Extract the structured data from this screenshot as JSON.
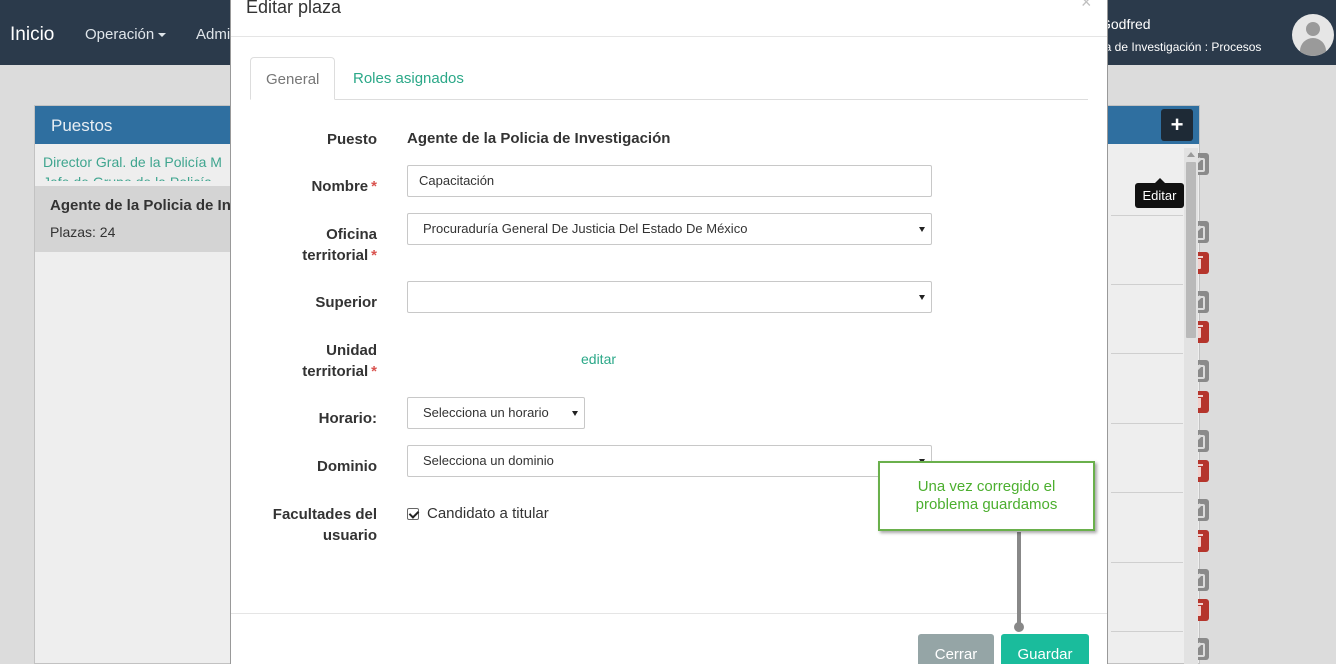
{
  "navbar": {
    "brand": "Inicio",
    "operacion": "Operación",
    "admin": "Admi",
    "user_name": "Godfred",
    "user_role": "cia de Investigación : Procesos"
  },
  "panel": {
    "title": "Puestos",
    "add_label": "+",
    "link1": "Director Gral. de la Policía M",
    "link2": "Jefe de Grupo de la Policía",
    "selected_title": "Agente de la Policia de Inve",
    "selected_plazas": "Plazas: 24",
    "tooltip": "Editar"
  },
  "modal": {
    "title": "Editar plaza",
    "close": "×",
    "tabs": [
      "General",
      "Roles asignados"
    ],
    "fields": {
      "puesto_label": "Puesto",
      "puesto_value": "Agente de la Policia de Investigación",
      "nombre_label": "Nombre",
      "nombre_value": "Capacitación",
      "oficina_label1": "Oficina",
      "oficina_label2": "territorial",
      "oficina_value": "Procuraduría General De Justicia Del Estado De México",
      "superior_label": "Superior",
      "superior_value": "",
      "unidad_label1": "Unidad",
      "unidad_label2": "territorial",
      "unidad_link": "editar",
      "horario_label": "Horario:",
      "horario_value": "Selecciona un horario",
      "dominio_label": "Dominio",
      "dominio_value": "Selecciona un dominio",
      "facultades_label1": "Facultades del",
      "facultades_label2": "usuario",
      "candidato_label": "Candidato a titular",
      "candidato_checked": true,
      "required_mark": "*"
    },
    "buttons": {
      "cerrar": "Cerrar",
      "guardar": "Guardar"
    }
  },
  "callout": {
    "line1": "Una vez corregido el",
    "line2": "problema guardamos"
  },
  "colors": {
    "navbar": "#2b3a4b",
    "panel_heading": "#2f6fa0",
    "accent": "#1abc9c",
    "link": "#2ba888",
    "delete": "#b5352c",
    "callout_border": "#6ab04c"
  }
}
